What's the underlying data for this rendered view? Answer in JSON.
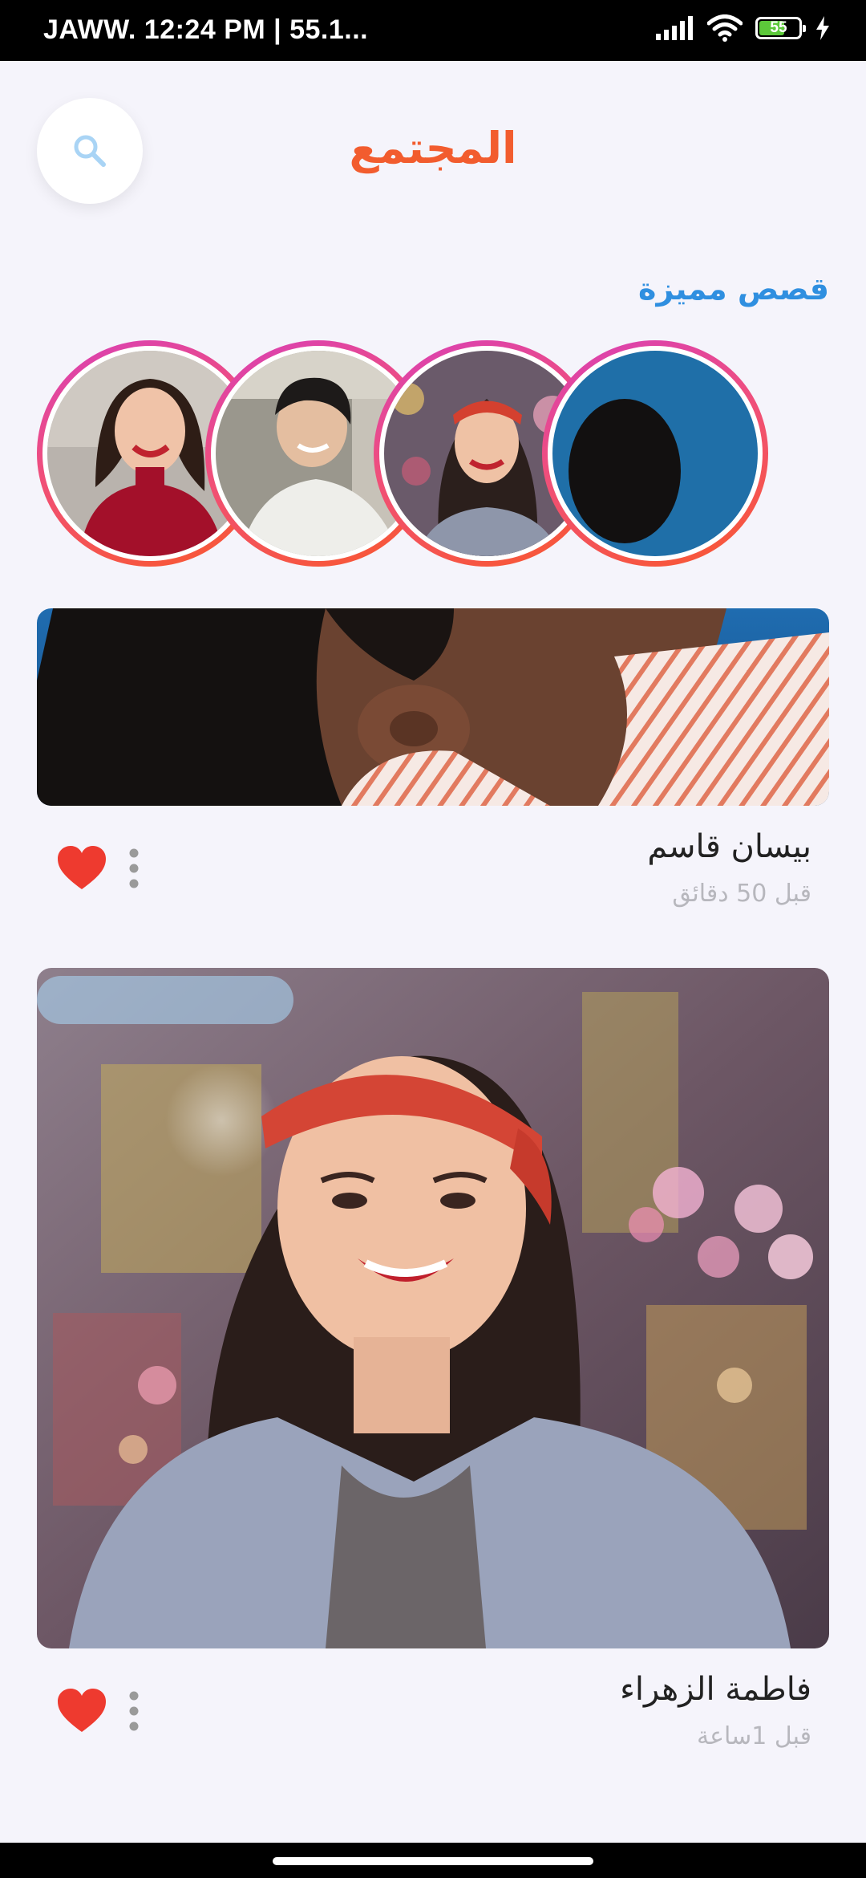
{
  "status_bar": {
    "left_text": "JAWW. 12:24 PM | 55.1...",
    "battery_level": "55"
  },
  "header": {
    "title": "المجتمع",
    "search_icon": "search-icon"
  },
  "stories": {
    "section_title": "قصص مميزة",
    "items": [
      {
        "name": "story-1"
      },
      {
        "name": "story-2"
      },
      {
        "name": "story-3"
      },
      {
        "name": "story-4"
      }
    ]
  },
  "posts": [
    {
      "author": "بيسان قاسم",
      "time": "قبل 50 دقائق",
      "liked": true
    },
    {
      "author": "فاطمة الزهراء",
      "time": "قبل 1ساعة",
      "liked": true
    }
  ],
  "colors": {
    "accent": "#f25c2e",
    "section_title": "#2f8fe0",
    "heart": "#ee3a2f",
    "background": "#f5f4fb"
  }
}
